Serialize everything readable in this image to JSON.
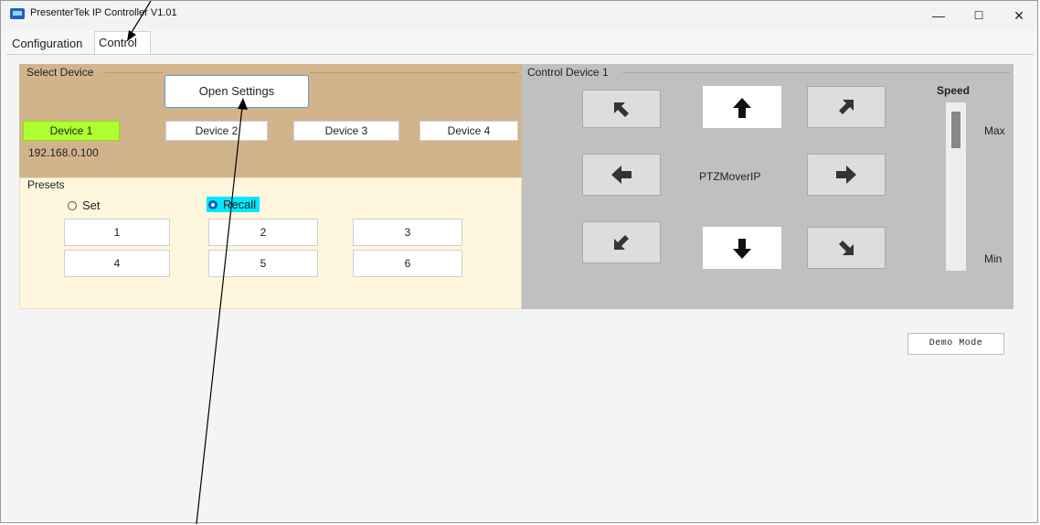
{
  "window": {
    "title": "PresenterTek IP Controller V1.01",
    "minimize": "—",
    "maximize": "☐",
    "close": "✕"
  },
  "tabs": [
    {
      "label": "Configuration"
    },
    {
      "label": "Control"
    }
  ],
  "select_device": {
    "title": "Select Device",
    "open_settings": "Open Settings",
    "devices": [
      {
        "label": "Device 1",
        "selected": true
      },
      {
        "label": "Device 2"
      },
      {
        "label": "Device 3"
      },
      {
        "label": "Device 4"
      }
    ],
    "ip": "192.168.0.100"
  },
  "presets": {
    "title": "Presets",
    "set_label": "Set",
    "recall_label": "Recall",
    "mode": "recall",
    "buttons": [
      "1",
      "2",
      "3",
      "4",
      "5",
      "6"
    ]
  },
  "control": {
    "title": "Control Device 1",
    "center_label": "PTZMoverIP",
    "speed_label": "Speed",
    "max_label": "Max",
    "min_label": "Min",
    "speed_level": 0.9
  },
  "demo_mode": "Demo Mode",
  "colors": {
    "device_panel": "#d2b48c",
    "selected_device": "#adff2f",
    "presets_panel": "#fff7dd",
    "control_panel": "#c0c0c0",
    "recall_highlight": "#00e8ff"
  }
}
